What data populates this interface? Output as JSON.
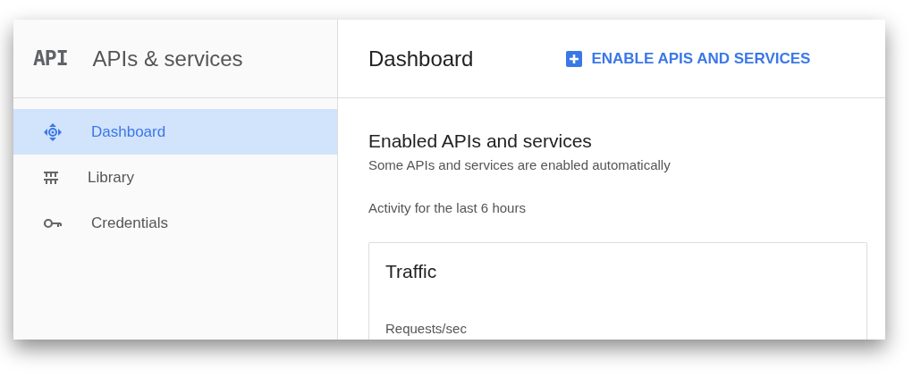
{
  "sidebar": {
    "logo": "API",
    "title": "APIs & services",
    "items": [
      {
        "label": "Dashboard",
        "kind": "dashboard",
        "selected": true
      },
      {
        "label": "Library",
        "kind": "library",
        "selected": false
      },
      {
        "label": "Credentials",
        "kind": "credentials",
        "selected": false
      }
    ]
  },
  "header": {
    "title": "Dashboard",
    "action": "ENABLE APIS AND SERVICES"
  },
  "section": {
    "title": "Enabled APIs and services",
    "subtitle": "Some APIs and services are enabled automatically",
    "activity": "Activity for the last 6 hours"
  },
  "traffic_card": {
    "title": "Traffic",
    "metric": "Requests/sec"
  }
}
